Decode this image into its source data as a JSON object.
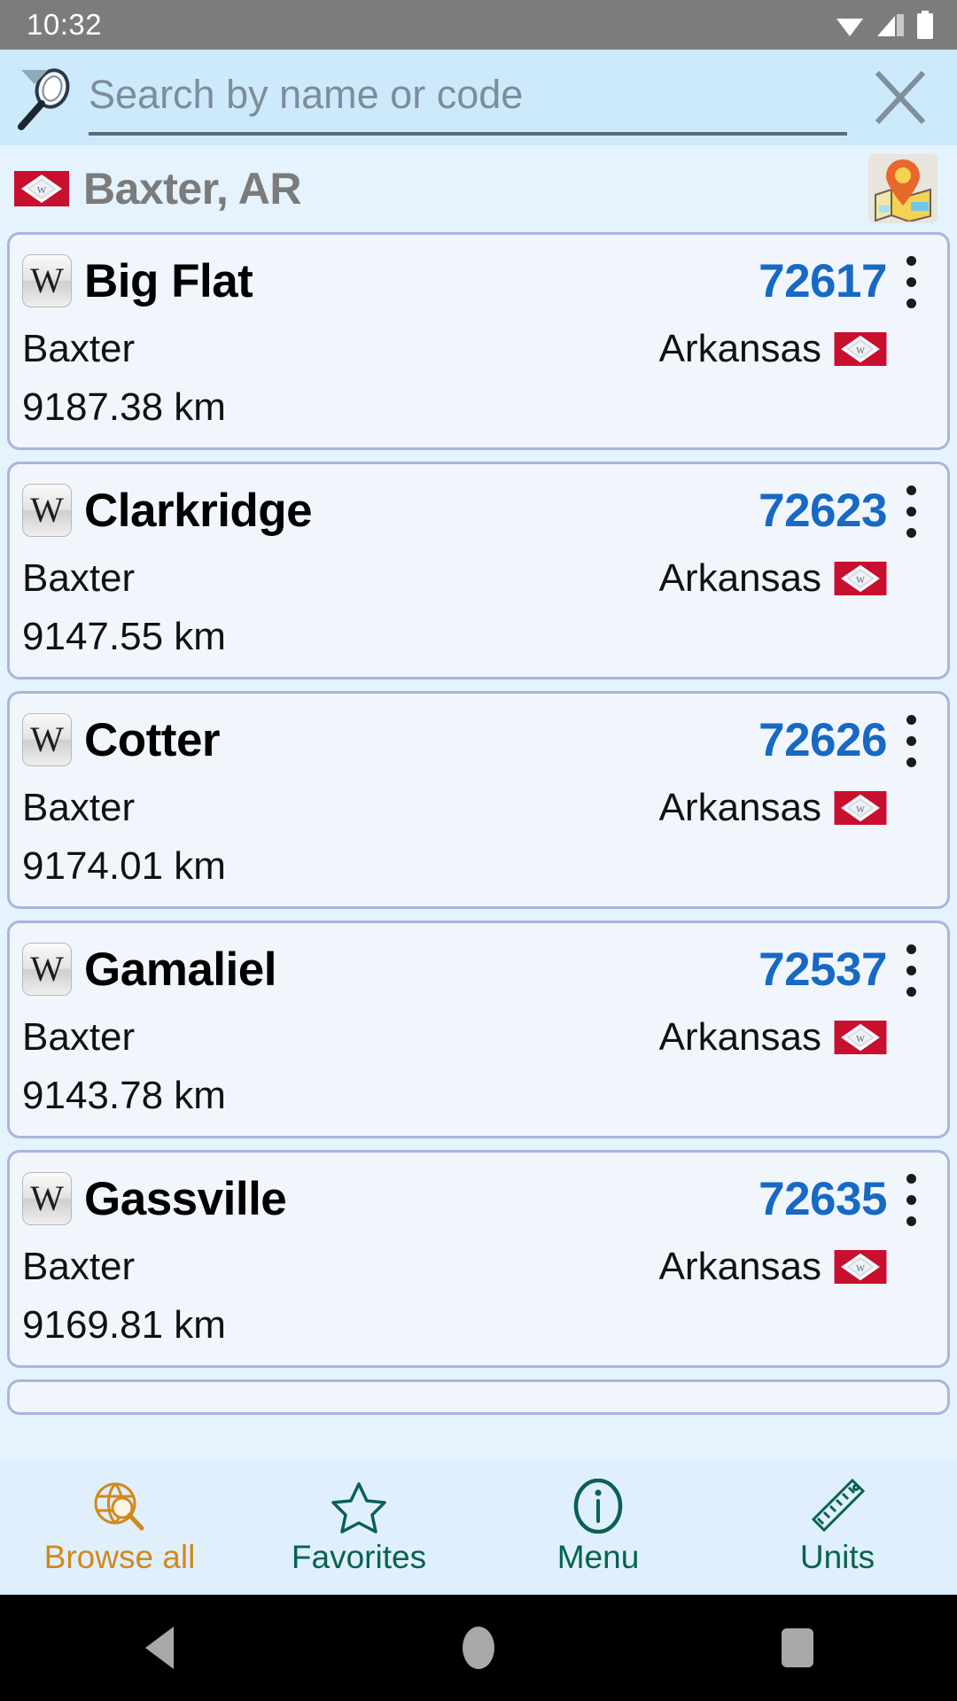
{
  "status_bar": {
    "time": "10:32",
    "icons": [
      "wifi-icon",
      "cell-signal-icon",
      "battery-icon"
    ]
  },
  "search": {
    "icon": "magnifier-icon",
    "placeholder": "Search by name or code",
    "value": "",
    "clear_icon": "close-x-icon"
  },
  "location_header": {
    "flag_icon": "arkansas-flag-icon",
    "title": "Baxter, AR",
    "map_button_icon": "map-pin-icon"
  },
  "colors": {
    "status_bar_bg": "#7c7c7c",
    "search_bg": "#cdeafc",
    "page_bg": "#e4f3fd",
    "card_bg": "#f1f6fd",
    "card_border": "#a9b5dd",
    "zip_blue": "#1769c4",
    "header_gray": "#7b7b7b",
    "nav_active": "#d3881c",
    "nav_inactive": "#0a6152",
    "flag_red": "#c8102e"
  },
  "list": {
    "items": [
      {
        "wiki_icon_letter": "W",
        "name": "Big Flat",
        "zip": "72617",
        "county": "Baxter",
        "state": "Arkansas",
        "state_flag": "arkansas-flag-icon",
        "distance": "9187.38 km",
        "menu_icon": "kebab-menu-icon"
      },
      {
        "wiki_icon_letter": "W",
        "name": "Clarkridge",
        "zip": "72623",
        "county": "Baxter",
        "state": "Arkansas",
        "state_flag": "arkansas-flag-icon",
        "distance": "9147.55 km",
        "menu_icon": "kebab-menu-icon"
      },
      {
        "wiki_icon_letter": "W",
        "name": "Cotter",
        "zip": "72626",
        "county": "Baxter",
        "state": "Arkansas",
        "state_flag": "arkansas-flag-icon",
        "distance": "9174.01 km",
        "menu_icon": "kebab-menu-icon"
      },
      {
        "wiki_icon_letter": "W",
        "name": "Gamaliel",
        "zip": "72537",
        "county": "Baxter",
        "state": "Arkansas",
        "state_flag": "arkansas-flag-icon",
        "distance": "9143.78 km",
        "menu_icon": "kebab-menu-icon"
      },
      {
        "wiki_icon_letter": "W",
        "name": "Gassville",
        "zip": "72635",
        "county": "Baxter",
        "state": "Arkansas",
        "state_flag": "arkansas-flag-icon",
        "distance": "9169.81 km",
        "menu_icon": "kebab-menu-icon"
      }
    ]
  },
  "bottom_nav": {
    "items": [
      {
        "label": "Browse all",
        "icon": "globe-search-icon",
        "active": true
      },
      {
        "label": "Favorites",
        "icon": "star-icon",
        "active": false
      },
      {
        "label": "Menu",
        "icon": "info-circle-icon",
        "active": false
      },
      {
        "label": "Units",
        "icon": "ruler-icon",
        "active": false
      }
    ]
  },
  "android_nav": {
    "back": "back-triangle-icon",
    "home": "home-circle-icon",
    "recents": "recents-square-icon"
  }
}
